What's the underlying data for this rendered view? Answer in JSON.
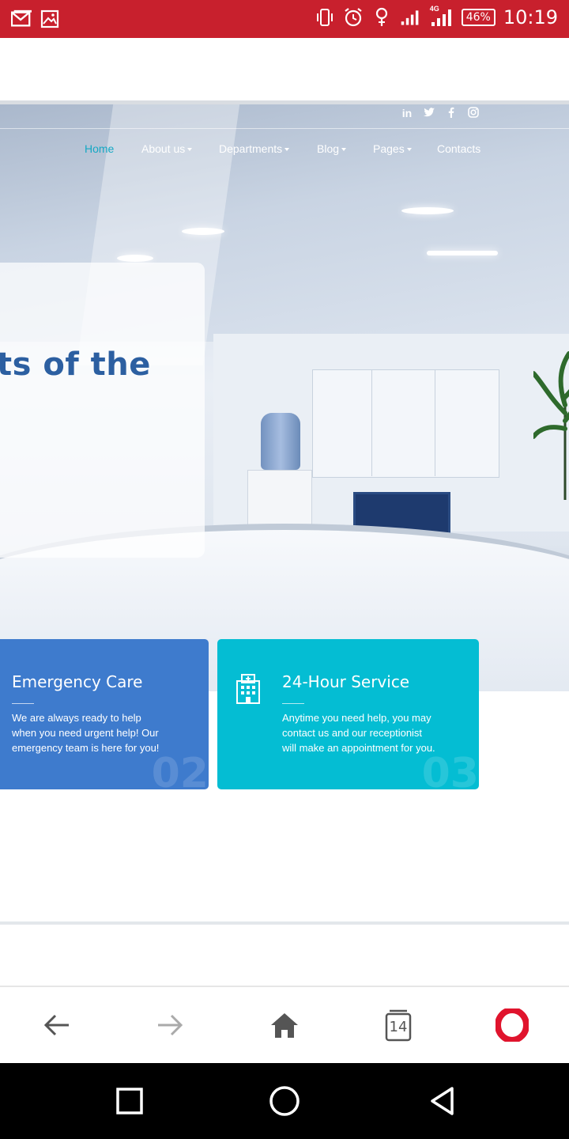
{
  "status_bar": {
    "icons": [
      "mail-icon",
      "image-icon",
      "vibrate-icon",
      "alarm-icon",
      "location-pin-icon",
      "signal-icon",
      "4g-signal-icon"
    ],
    "network_label": "4G",
    "battery": "46%",
    "time": "10:19"
  },
  "site": {
    "social": [
      "in",
      "twitter-icon",
      "facebook-icon",
      "instagram-icon"
    ],
    "nav": [
      {
        "label": "Home",
        "active": true,
        "dropdown": false
      },
      {
        "label": "About us",
        "active": false,
        "dropdown": true
      },
      {
        "label": "Departments",
        "active": false,
        "dropdown": true
      },
      {
        "label": "Blog",
        "active": false,
        "dropdown": true
      },
      {
        "label": "Pages",
        "active": false,
        "dropdown": true
      },
      {
        "label": "Contacts",
        "active": false,
        "dropdown": false
      }
    ],
    "hero_heading": "ts of the",
    "cards": [
      {
        "title": "Emergency Care",
        "text": "We are always ready to help\nwhen you need urgent help! Our\nemergency team is here for you!",
        "number": "02",
        "color": "#3e7bcd"
      },
      {
        "title": "24-Hour Service",
        "text": "Anytime you need help, you may\ncontact us and our receptionist\nwill make an appointment for you.",
        "number": "03",
        "color": "#04bdd3",
        "icon": "hospital-icon"
      }
    ]
  },
  "browser_bar": {
    "tab_count": "14",
    "buttons": [
      "back-arrow-icon",
      "forward-arrow-icon",
      "home-icon",
      "tabs-icon",
      "opera-icon"
    ]
  },
  "colors": {
    "status_bar": "#c8202d",
    "nav_active": "#15a8c4",
    "heading": "#2c5fa1",
    "opera_red": "#e0142d"
  }
}
